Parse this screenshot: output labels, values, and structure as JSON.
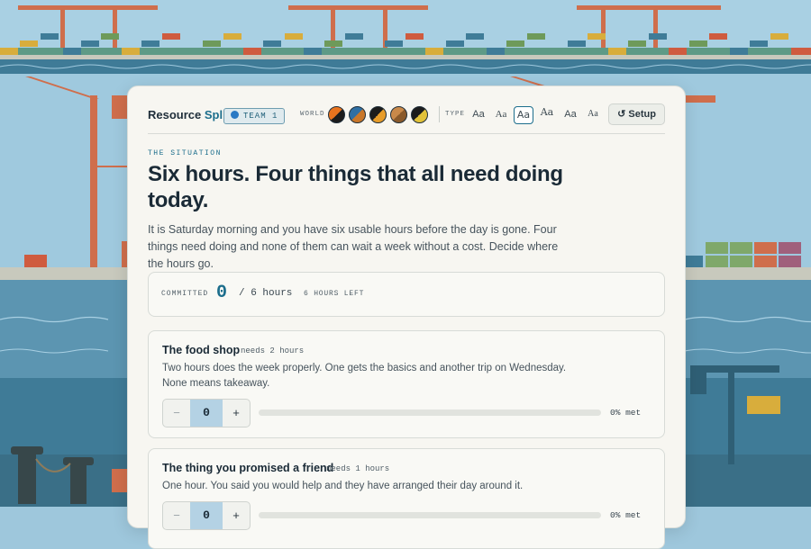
{
  "brand": {
    "name_part1": "Resource",
    "name_part2": "Split"
  },
  "team_badge": "TEAM 1",
  "world": {
    "label": "WORLD",
    "swatches": [
      {
        "name": "orange-black",
        "colors": [
          "#e8731e",
          "#1c1c1c"
        ]
      },
      {
        "name": "blue-orange",
        "colors": [
          "#2f6fa3",
          "#c9772a"
        ]
      },
      {
        "name": "orange-black-2",
        "colors": [
          "#1c1c1c",
          "#e79c2a"
        ]
      },
      {
        "name": "tan-brown",
        "colors": [
          "#c9894a",
          "#8a5a2b"
        ]
      },
      {
        "name": "yellow-black",
        "colors": [
          "#1c1c1c",
          "#e2c23a"
        ]
      }
    ]
  },
  "type": {
    "label": "TYPE",
    "options": [
      "Aa",
      "Aa",
      "Aa",
      "Aa",
      "Aa",
      "Aa"
    ],
    "selected_index": 2
  },
  "setup_button": "↺ Setup",
  "situation": {
    "kicker": "THE SITUATION",
    "headline": "Six hours. Four things that all need doing today.",
    "lede": "It is Saturday morning and you have six usable hours before the day is gone. Four things need doing and none of them can wait a week without a cost. Decide where the hours go."
  },
  "committed": {
    "label": "COMMITTED",
    "value": "0",
    "total": "/ 6 hours",
    "left": "6 HOURS LEFT"
  },
  "tasks": [
    {
      "name": "The food shop",
      "needs": "needs 2 hours",
      "description": "Two hours does the week properly. One gets the basics and another trip on Wednesday. None means takeaway.",
      "value": "0",
      "met_label": "0% met",
      "met_fraction": 0
    },
    {
      "name": "The thing you promised a friend",
      "needs": "needs 1 hours",
      "description": "One hour. You said you would help and they have arranged their day around it.",
      "value": "0",
      "met_label": "0% met",
      "met_fraction": 0
    }
  ],
  "stepper": {
    "minus": "−",
    "plus": "+"
  },
  "colors": {
    "accent": "#1c6e8c",
    "card": "#f7f6f1",
    "sea": "#3f7c98",
    "crane": "#d2704f"
  }
}
